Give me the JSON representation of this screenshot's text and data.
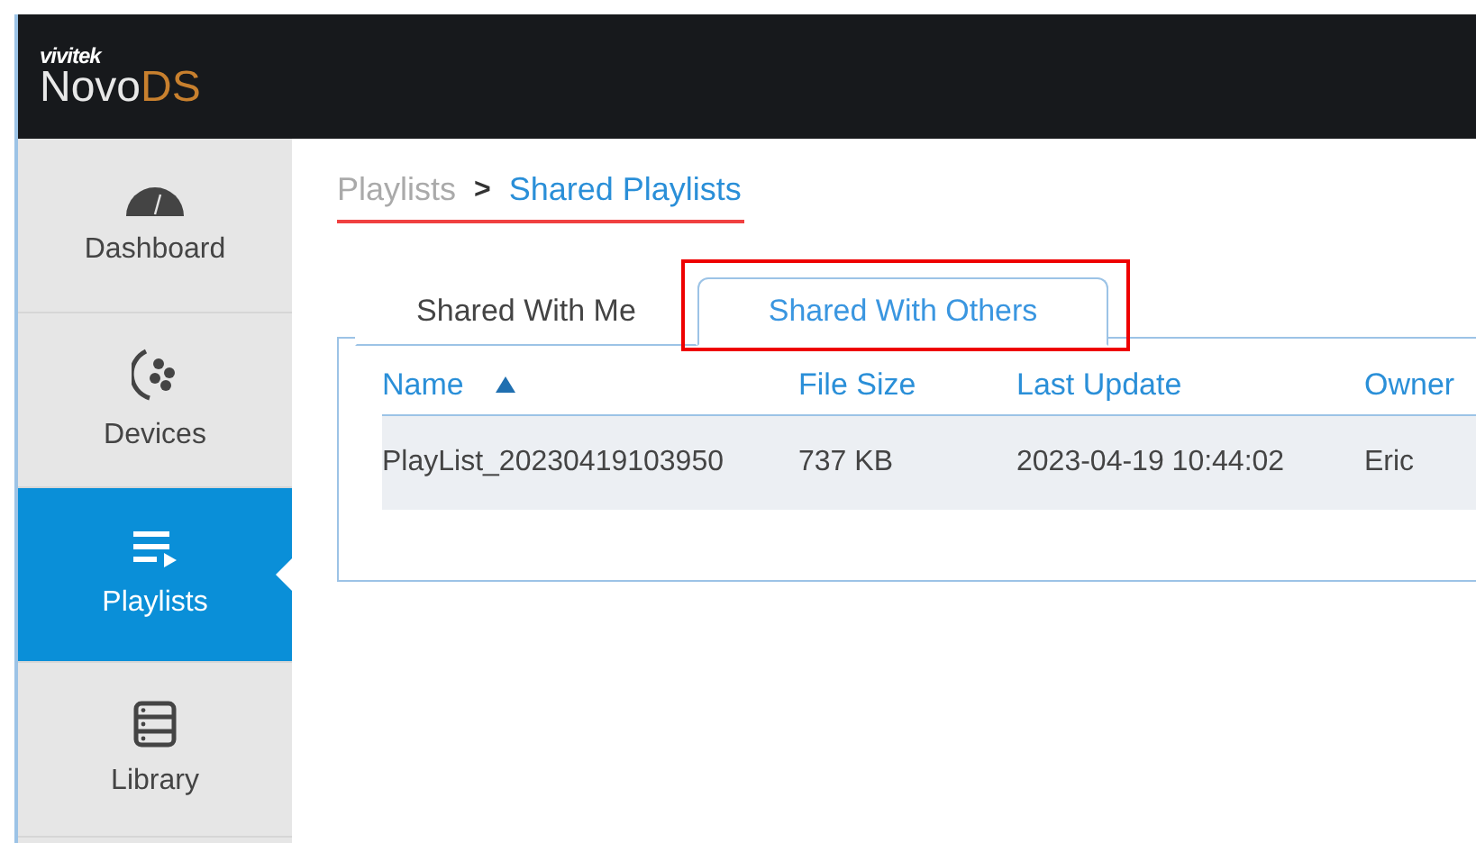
{
  "logo": {
    "brand": "vivitek",
    "name": "Novo",
    "suffix": "DS"
  },
  "sidebar": {
    "items": [
      {
        "label": "Dashboard",
        "kind": "dashboard",
        "selected": false
      },
      {
        "label": "Devices",
        "kind": "devices",
        "selected": false
      },
      {
        "label": "Playlists",
        "kind": "playlists",
        "selected": true
      },
      {
        "label": "Library",
        "kind": "library",
        "selected": false
      }
    ]
  },
  "breadcrumb": {
    "parent": "Playlists",
    "separator": ">",
    "current": "Shared Playlists"
  },
  "tabs": [
    {
      "label": "Shared With Me",
      "selected": false
    },
    {
      "label": "Shared With Others",
      "selected": true
    }
  ],
  "table": {
    "columns": [
      {
        "label": "Name",
        "sorted": true
      },
      {
        "label": "File Size",
        "sorted": false
      },
      {
        "label": "Last Update",
        "sorted": false
      },
      {
        "label": "Owner",
        "sorted": false
      }
    ],
    "rows": [
      [
        "PlayList_20230419103950",
        "737 KB",
        "2023-04-19 10:44:02",
        "Eric"
      ]
    ]
  }
}
